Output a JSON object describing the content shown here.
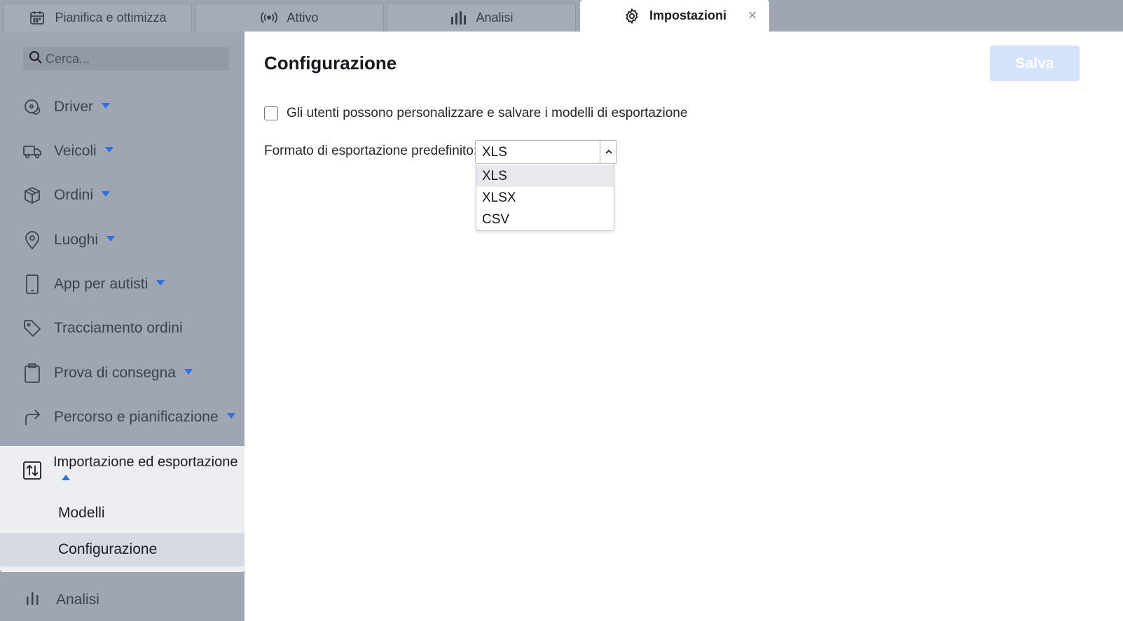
{
  "tabs": [
    {
      "label": "Pianifica e ottimizza",
      "icon": "calendar-icon"
    },
    {
      "label": "Attivo",
      "icon": "broadcast-icon"
    },
    {
      "label": "Analisi",
      "icon": "bar-chart-icon"
    },
    {
      "label": "Impostazioni",
      "icon": "gear-icon",
      "active": true
    }
  ],
  "sidebar": {
    "search_placeholder": "Cerca...",
    "items": [
      {
        "label": "Driver",
        "icon": "steering-icon",
        "has_caret": true
      },
      {
        "label": "Veicoli",
        "icon": "truck-icon",
        "has_caret": true
      },
      {
        "label": "Ordini",
        "icon": "box-icon",
        "has_caret": true
      },
      {
        "label": "Luoghi",
        "icon": "map-pin-icon",
        "has_caret": true
      },
      {
        "label": "App per autisti",
        "icon": "phone-icon",
        "has_caret": true
      },
      {
        "label": "Tracciamento ordini",
        "icon": "tag-icon",
        "has_caret": false
      },
      {
        "label": "Prova di consegna",
        "icon": "clipboard-icon",
        "has_caret": true
      },
      {
        "label": "Percorso e pianificazione",
        "icon": "route-arrow-icon",
        "has_caret": true
      }
    ],
    "expanded": {
      "label": "Importazione ed esportazione",
      "icon": "import-export-icon",
      "children": [
        {
          "label": "Modelli",
          "selected": false
        },
        {
          "label": "Configurazione",
          "selected": true
        }
      ]
    },
    "bottom_item": {
      "label": "Analisi",
      "icon": "bar-chart-icon"
    }
  },
  "main": {
    "title": "Configurazione",
    "save_label": "Salva",
    "checkbox_label": "Gli utenti possono personalizzare e salvare i modelli di esportazione",
    "checkbox_checked": false,
    "format_label": "Formato di esportazione predefinito:",
    "format_value": "XLS",
    "format_options": [
      "XLS",
      "XLSX",
      "CSV"
    ]
  },
  "colors": {
    "accent": "#2f6fe0",
    "save_disabled": "#d4e2fb",
    "sidebar_bg": "#9ea5b3",
    "selected_bg": "#d6dae2"
  }
}
